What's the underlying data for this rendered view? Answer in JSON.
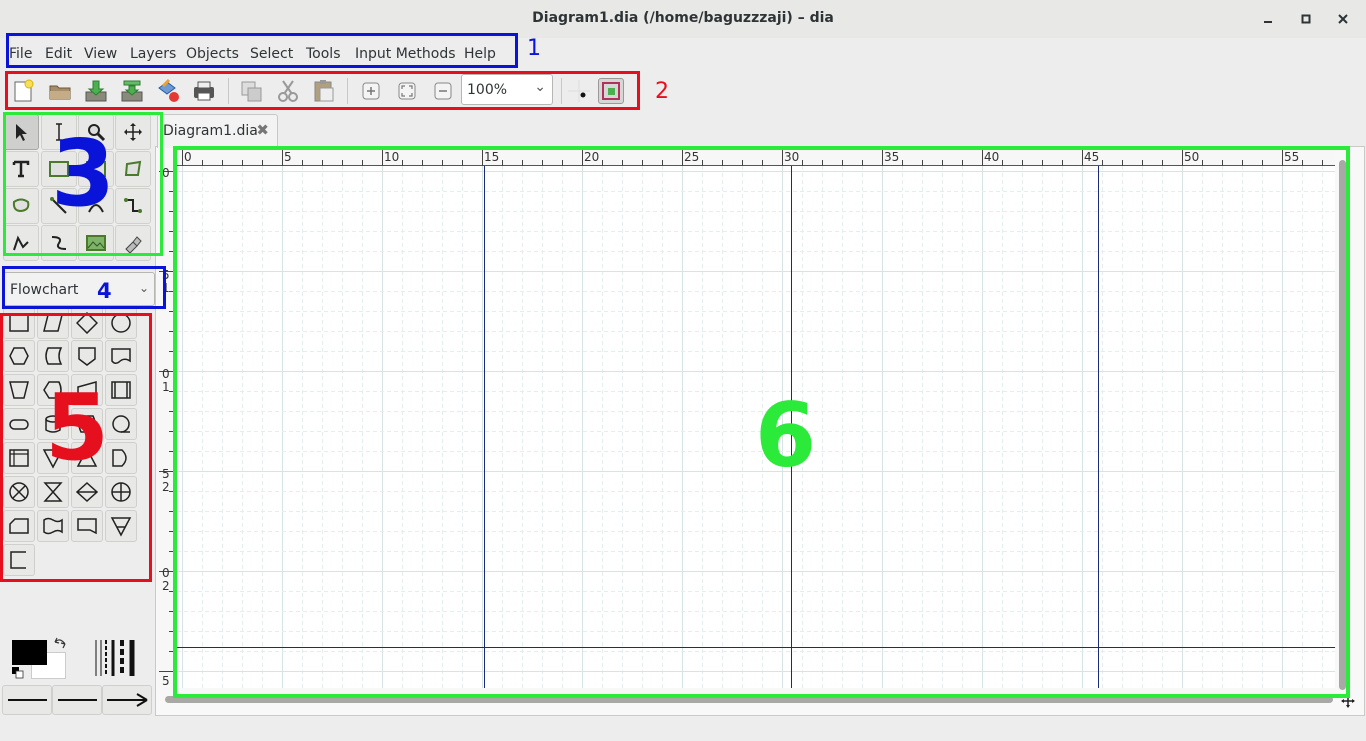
{
  "window": {
    "title": "Diagram1.dia (/home/baguzzzaji) – dia"
  },
  "menubar": {
    "items": [
      {
        "label": "File"
      },
      {
        "label": "Edit"
      },
      {
        "label": "View"
      },
      {
        "label": "Layers"
      },
      {
        "label": "Objects"
      },
      {
        "label": "Select"
      },
      {
        "label": "Tools"
      },
      {
        "label": "Input Methods"
      },
      {
        "label": "Help"
      }
    ]
  },
  "toolbar": {
    "zoom": "100%"
  },
  "sheet_selector": {
    "value": "Flowchart"
  },
  "document": {
    "tab_label": "Diagram1.dia"
  },
  "rulers": {
    "horizontal": [
      "0",
      "5",
      "10",
      "15",
      "20",
      "25",
      "30",
      "35",
      "40",
      "45",
      "50",
      "55"
    ],
    "vertical": [
      "0",
      "5",
      "1",
      "0",
      "1",
      "5",
      "2",
      "0",
      "2",
      "5"
    ]
  },
  "annotations": {
    "n1": "1",
    "n2": "2",
    "n3": "3",
    "n4": "4",
    "n5": "5",
    "n6": "6",
    "blue": "#0a14d8",
    "red": "#e60f1e",
    "green": "#2bea3a"
  },
  "colors": {
    "foreground": "#000000",
    "background": "#ffffff",
    "guide": "#1c2a7a"
  }
}
